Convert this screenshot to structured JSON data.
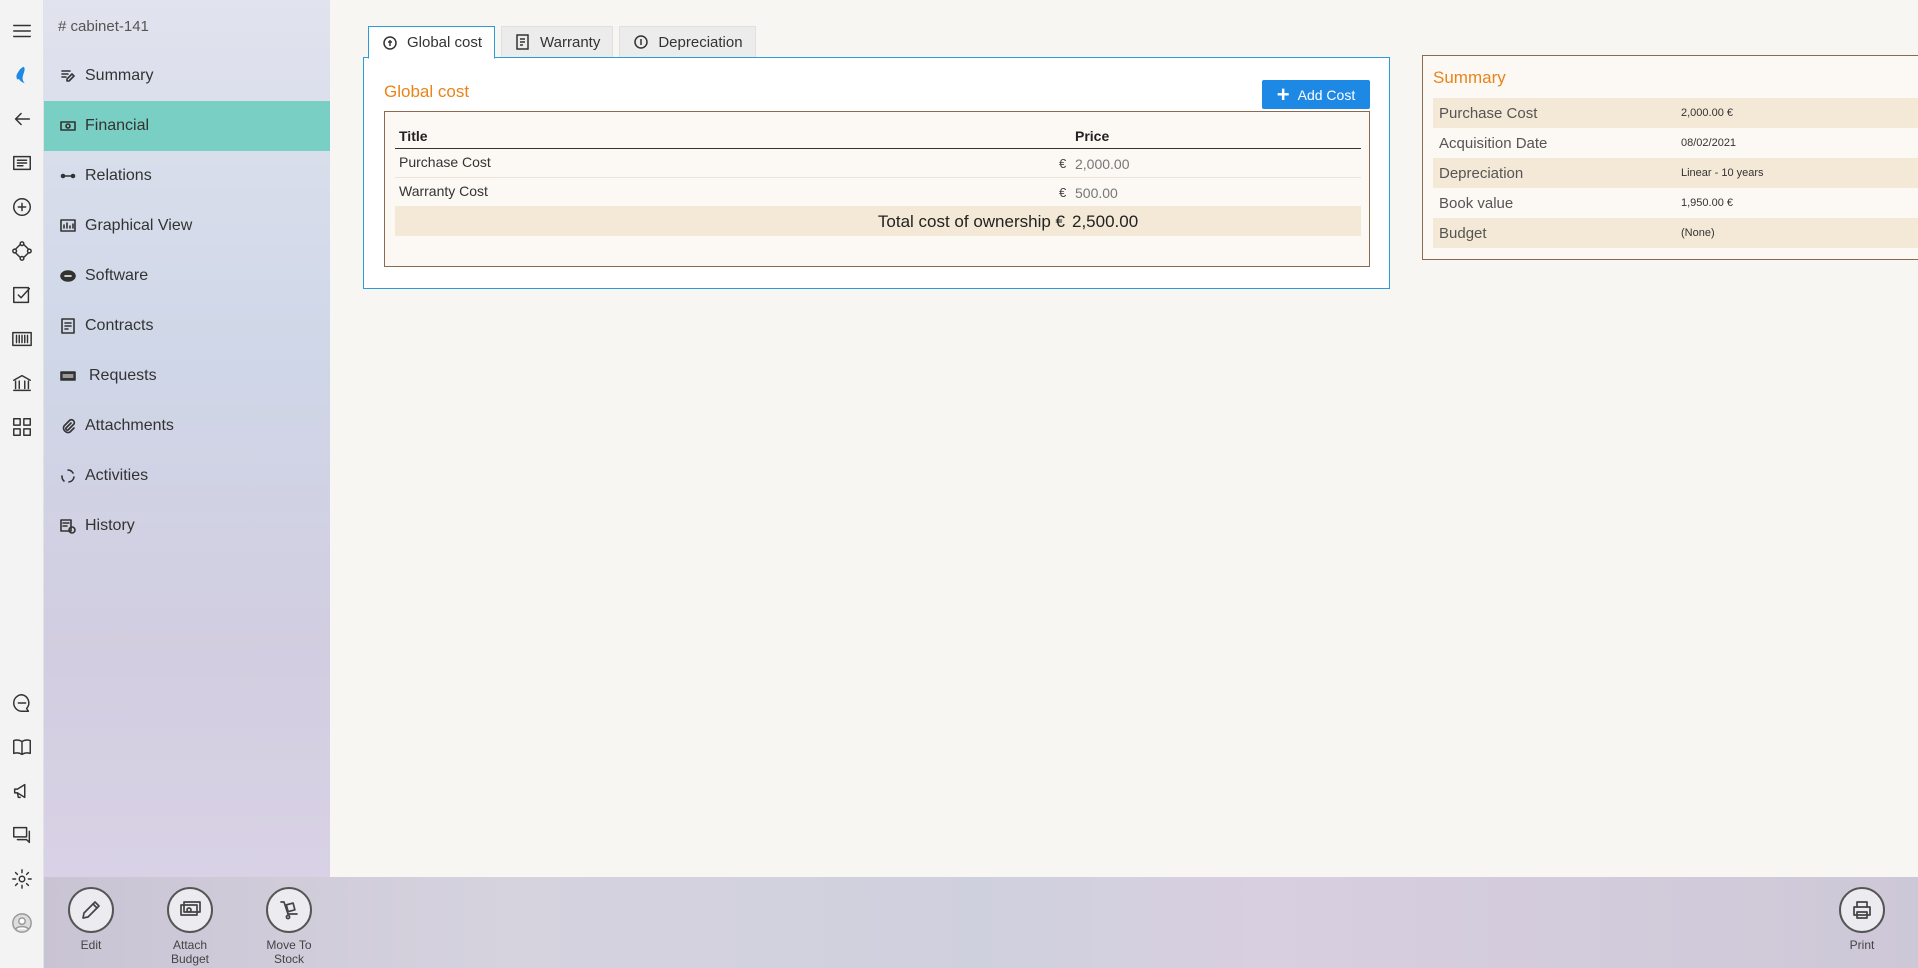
{
  "breadcrumb": "# cabinet-141",
  "sidebar": {
    "items": [
      {
        "label": "Summary",
        "icon": "pencil-note-icon"
      },
      {
        "label": "Financial",
        "icon": "money-icon",
        "active": true
      },
      {
        "label": "Relations",
        "icon": "link-icon"
      },
      {
        "label": "Graphical View",
        "icon": "graph-icon"
      },
      {
        "label": "Software",
        "icon": "software-icon"
      },
      {
        "label": "Contracts",
        "icon": "contract-icon"
      },
      {
        "label": "Requests",
        "icon": "keyboard-icon"
      },
      {
        "label": "Attachments",
        "icon": "paperclip-icon"
      },
      {
        "label": "Activities",
        "icon": "cycle-icon"
      },
      {
        "label": "History",
        "icon": "history-icon"
      }
    ]
  },
  "tabs": [
    {
      "label": "Global cost",
      "active": true
    },
    {
      "label": "Warranty"
    },
    {
      "label": "Depreciation"
    }
  ],
  "global_cost": {
    "title": "Global cost",
    "add_button": "Add Cost",
    "columns": {
      "title": "Title",
      "price": "Price"
    },
    "rows": [
      {
        "title": "Purchase Cost",
        "currency": "€",
        "price": "2,000.00"
      },
      {
        "title": "Warranty Cost",
        "currency": "€",
        "price": "500.00"
      }
    ],
    "total_label": "Total cost of ownership €",
    "total_value": "2,500.00"
  },
  "summary": {
    "title": "Summary",
    "rows": [
      {
        "key": "Purchase Cost",
        "value": "2,000.00 €"
      },
      {
        "key": "Acquisition Date",
        "value": "08/02/2021"
      },
      {
        "key": "Depreciation",
        "value": "Linear - 10 years"
      },
      {
        "key": "Book value",
        "value": "1,950.00 €"
      },
      {
        "key": "Budget",
        "value": "(None)"
      }
    ]
  },
  "toolbar": {
    "edit": "Edit",
    "attach_budget": "Attach Budget",
    "move_to_stock": "Move To Stock",
    "print": "Print"
  },
  "colors": {
    "accent": "#e8841a",
    "active_nav": "#79cfc4",
    "primary_button": "#1e88e5",
    "tab_border": "#2f9bd6"
  }
}
